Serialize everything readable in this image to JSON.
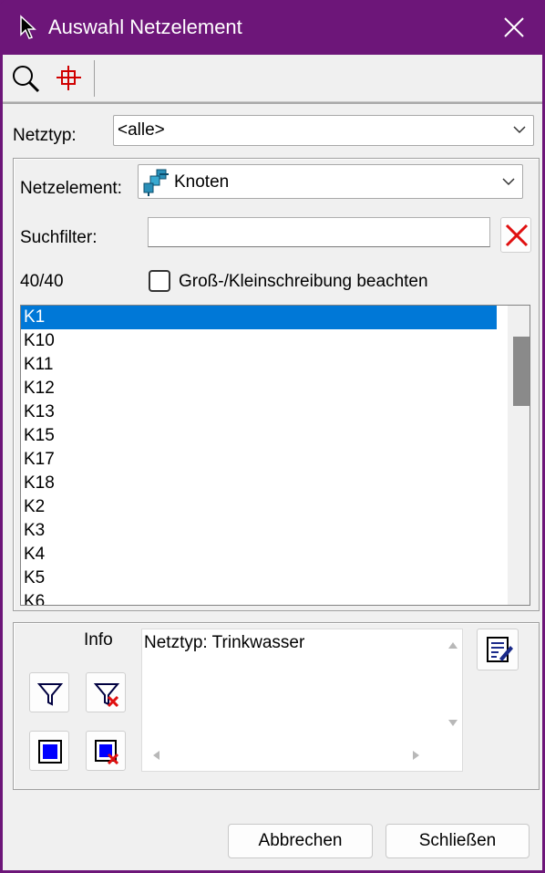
{
  "window": {
    "title": "Auswahl Netzelement"
  },
  "toolbar": {
    "items": [
      "magnifier-icon",
      "crosshair-icon"
    ]
  },
  "netztyp": {
    "label": "Netztyp:",
    "value": "<alle>"
  },
  "netzelement": {
    "label": "Netzelement:",
    "value": "Knoten",
    "icon": "node-network-icon"
  },
  "suchfilter": {
    "label": "Suchfilter:",
    "value": ""
  },
  "counter": "40/40",
  "case_sensitive": {
    "label": "Groß-/Kleinschreibung beachten",
    "checked": false
  },
  "list": {
    "items": [
      "K1",
      "K10",
      "K11",
      "K12",
      "K13",
      "K15",
      "K17",
      "K18",
      "K2",
      "K3",
      "K4",
      "K5",
      "K6"
    ],
    "selected": "K1"
  },
  "info": {
    "label": "Info",
    "text": "Netztyp: Trinkwasser"
  },
  "buttons": {
    "cancel": "Abbrechen",
    "close": "Schließen"
  },
  "colors": {
    "titlebar": "#6d1679",
    "selection": "#0078d7",
    "accent_icon": "#0000ff",
    "delete_red": "#e01010"
  }
}
